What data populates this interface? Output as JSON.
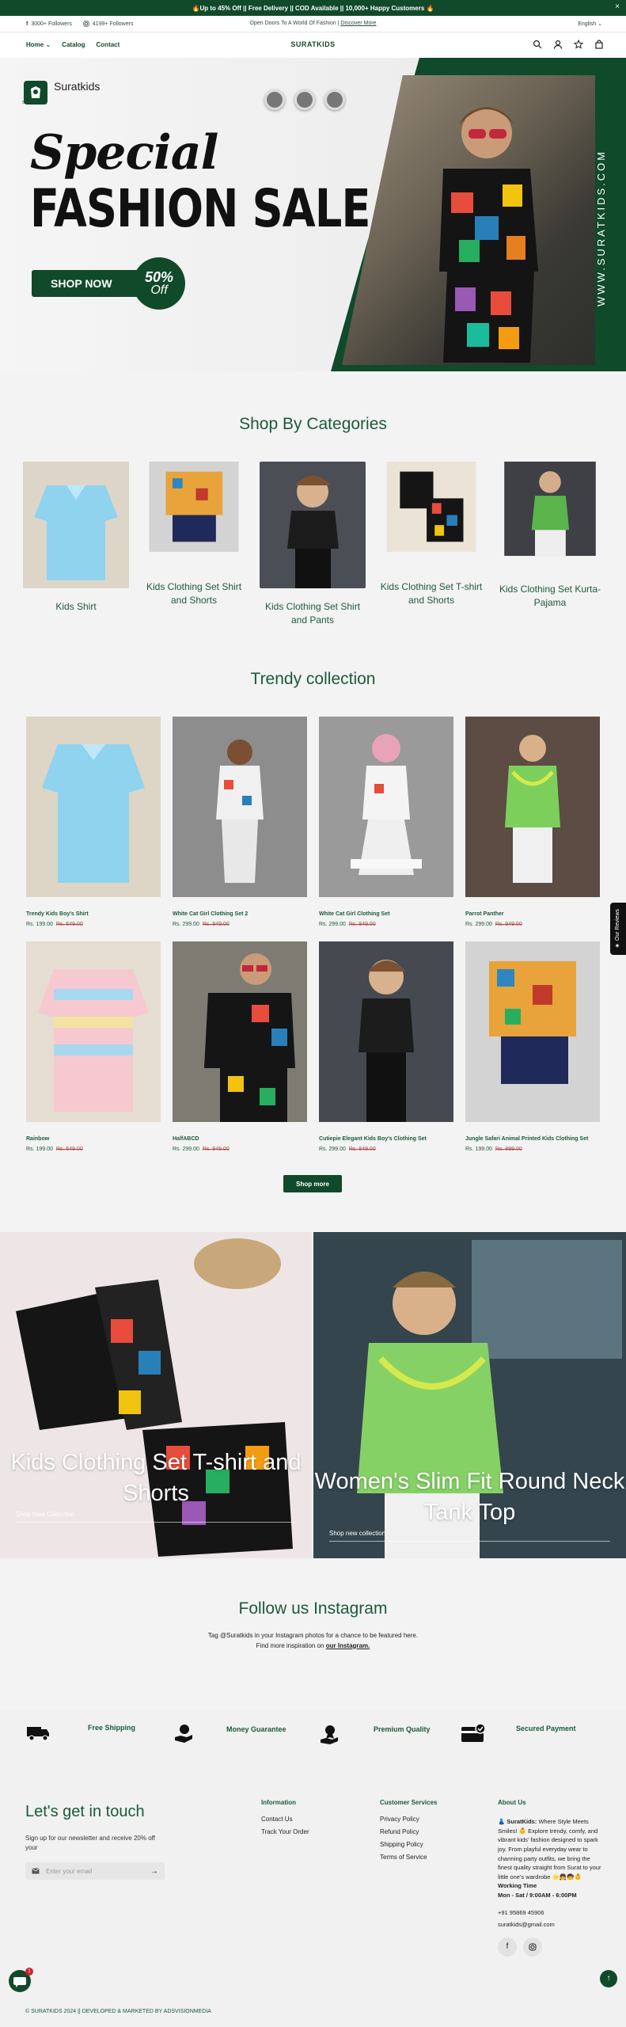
{
  "announcement": {
    "text": "🔥Up to 45% Off || Free Delivery || COD Available || 10,000+ Happy Customers 🔥",
    "close": "×"
  },
  "topbar": {
    "facebook": "3000+ Followers",
    "instagram": "4199+ Followers",
    "center_text": "Open Doors To A World Of Fashion |",
    "center_link": "Discover More",
    "language": "English"
  },
  "nav": {
    "home": "Home",
    "catalog": "Catalog",
    "contact": "Contact",
    "logo": "SURATKIDS"
  },
  "hero": {
    "brand": "Suratkids",
    "brand_small": "SURATKIDS",
    "line1": "Special",
    "line2": "FASHION SALE",
    "cta": "SHOP NOW",
    "pct": "50%",
    "off": "Off",
    "vertical": "WWW.SURATKIDS.COM"
  },
  "categories": {
    "title": "Shop By Categories",
    "items": [
      {
        "label": "Kids Shirt"
      },
      {
        "label": "Kids Clothing Set Shirt and Shorts"
      },
      {
        "label": "Kids Clothing Set Shirt and Pants"
      },
      {
        "label": "Kids Clothing Set T-shirt and Shorts"
      },
      {
        "label": "Kids Clothing Set Kurta-Pajama"
      }
    ]
  },
  "trendy": {
    "title": "Trendy collection",
    "products": [
      {
        "name": "Trendy Kids Boy's Shirt",
        "price": "Rs. 199.00",
        "compare": "Rs. 649.00"
      },
      {
        "name": "White Cat Girl Clothing Set 2",
        "price": "Rs. 299.00",
        "compare": "Rs. 949.00"
      },
      {
        "name": "White Cat Girl Clothing Set",
        "price": "Rs. 299.00",
        "compare": "Rs. 949.00"
      },
      {
        "name": "Parrot Panther",
        "price": "Rs. 299.00",
        "compare": "Rs. 949.00"
      },
      {
        "name": "Rainbow",
        "price": "Rs. 199.00",
        "compare": "Rs. 649.00"
      },
      {
        "name": "HalfABCD",
        "price": "Rs. 299.00",
        "compare": "Rs. 949.00"
      },
      {
        "name": "Cutiepie Elegant Kids Boy's Clothing Set",
        "price": "Rs. 299.00",
        "compare": "Rs. 849.00"
      },
      {
        "name": "Jungle Safari Animal Printed Kids Clothing Set",
        "price": "Rs. 199.00",
        "compare": "Rs. 899.00"
      }
    ],
    "shop_more": "Shop more"
  },
  "reviews_tab": "★ Our Reviews",
  "collections": [
    {
      "title": "Kids Clothing Set T-shirt and Shorts",
      "sub": "Shop New Collection"
    },
    {
      "title": "Women's Slim Fit Round Neck Tank Top",
      "sub": "Shop new collection"
    }
  ],
  "instagram": {
    "title": "Follow us Instagram",
    "line1": "Tag @Suratkids in your Instagram photos for a chance to be featured here.",
    "line2": "Find more inspiration on",
    "link": "our Instagram."
  },
  "features": [
    {
      "label": "Free Shipping",
      "icon": "truck-icon"
    },
    {
      "label": "Money Guarantee",
      "icon": "money-hand-icon"
    },
    {
      "label": "Premium Quality",
      "icon": "badge-hand-icon"
    },
    {
      "label": "Secured Payment",
      "icon": "card-check-icon"
    }
  ],
  "footer": {
    "heading": "Let's get in touch",
    "newsletter": "Sign up for our newsletter and receive 20% off your",
    "email_placeholder": "Enter your email",
    "info_title": "Information",
    "info": [
      "Contact Us",
      "Track Your Order"
    ],
    "cs_title": "Customer Services",
    "cs": [
      "Privacy Policy",
      "Refund Policy",
      "Shipping Policy",
      "Terms of Service"
    ],
    "about_title": "About Us",
    "about_brand": "👗 SuratKids:",
    "about_text": "Where Style Meets Smiles! 👶 Explore trendy, comfy, and vibrant kids' fashion designed to spark joy. From playful everyday wear to charming party outfits, we bring the finest quality straight from Surat to your little one's wardrobe 🌟👧🧒👶",
    "hours_title": "Working Time",
    "hours": "Mon - Sat / 9:00AM - 6:00PM",
    "phone": "+91 95869 45906",
    "email": "suratkids@gmail.com",
    "copyright": "© SURATKIDS 2024 || DEVELOPED & MARKETED BY ADSVISIONMEDIA"
  },
  "chat_badge": "1",
  "colors": {
    "brand_green": "#114a2b",
    "heading_green": "#1b5a3a",
    "compare_red": "#b04545"
  }
}
